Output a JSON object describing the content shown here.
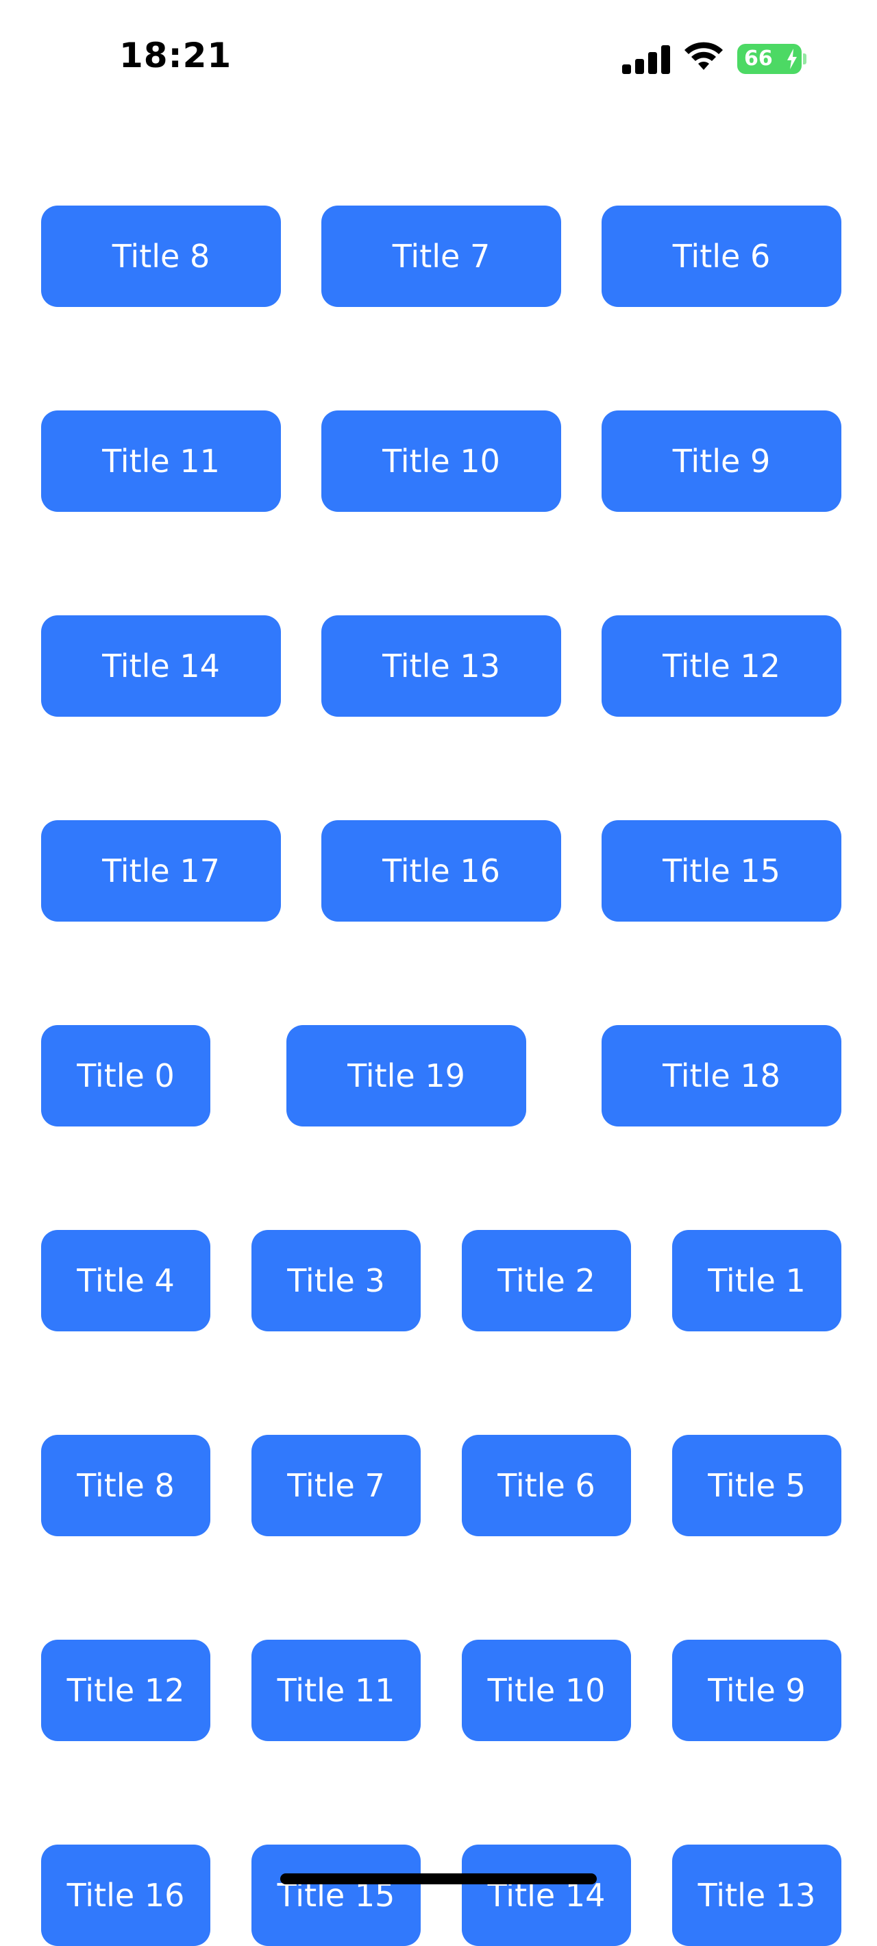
{
  "status_bar": {
    "time": "18:21",
    "battery_level": "66",
    "icons": [
      "signal-icon",
      "wifi-icon",
      "battery-icon",
      "charging-bolt-icon"
    ],
    "battery_color": "#4cd964"
  },
  "theme": {
    "tile_color": "#3179fc",
    "tile_text_color": "#ffffff",
    "background": "#ffffff"
  },
  "rows": [
    {
      "items": [
        "Title 8",
        "Title 7",
        "Title 6"
      ]
    },
    {
      "items": [
        "Title 11",
        "Title 10",
        "Title 9"
      ]
    },
    {
      "items": [
        "Title 14",
        "Title 13",
        "Title 12"
      ]
    },
    {
      "items": [
        "Title 17",
        "Title 16",
        "Title 15"
      ]
    },
    {
      "items": [
        "Title 0",
        "Title 19",
        "Title 18"
      ]
    },
    {
      "items": [
        "Title 4",
        "Title 3",
        "Title 2",
        "Title 1"
      ]
    },
    {
      "items": [
        "Title 8",
        "Title 7",
        "Title 6",
        "Title 5"
      ]
    },
    {
      "items": [
        "Title 12",
        "Title 11",
        "Title 10",
        "Title 9"
      ]
    },
    {
      "items": [
        "Title 16",
        "Title 15",
        "Title 14",
        "Title 13"
      ]
    }
  ]
}
